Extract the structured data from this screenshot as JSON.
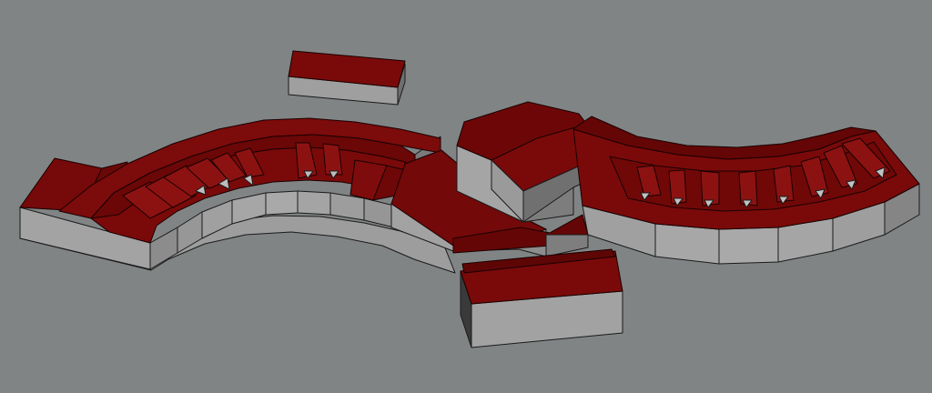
{
  "viewport": {
    "background_color": "#808485"
  },
  "scene": {
    "description_label": "",
    "colors": {
      "roof": "#7a0a0a",
      "roof_dark": "#5c0606",
      "roof_light": "#8f1515",
      "wall": "#9a9a9a",
      "wall_dark": "#6e6e6e",
      "wall_light": "#b4b4b4",
      "outline": "#1a1a1a"
    }
  }
}
